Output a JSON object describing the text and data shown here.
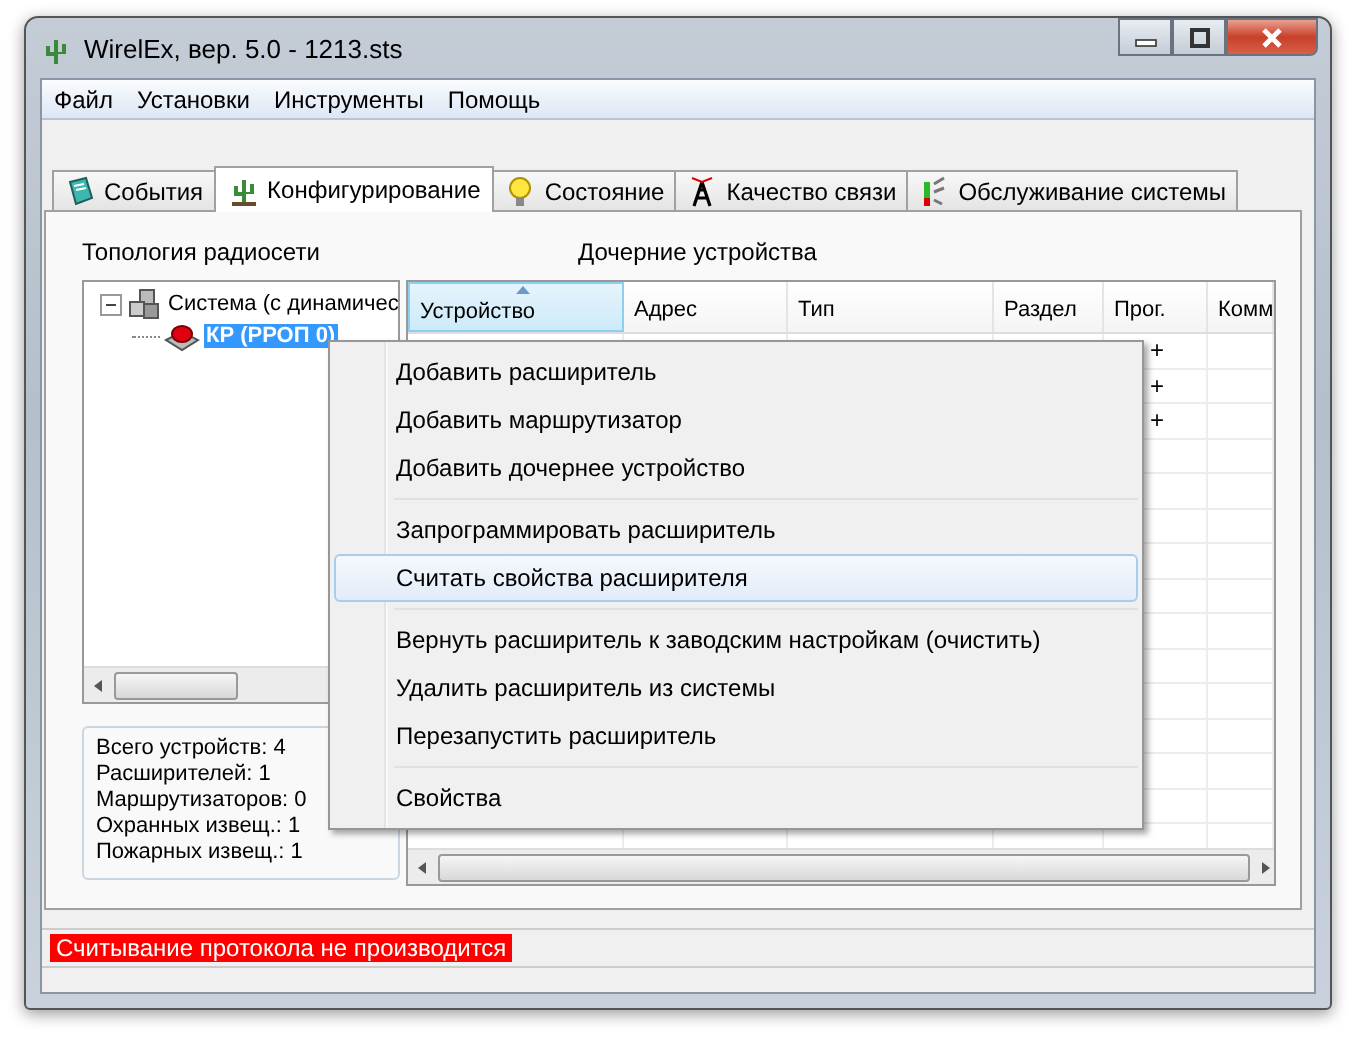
{
  "window": {
    "title": "WirelEx, вер. 5.0 - 1213.sts"
  },
  "menu": [
    "Файл",
    "Установки",
    "Инструменты",
    "Помощь"
  ],
  "tabs": [
    {
      "label": "События",
      "kind": "book",
      "selected": false
    },
    {
      "label": "Конфигурирование",
      "kind": "cactus",
      "selected": true
    },
    {
      "label": "Состояние",
      "kind": "bulb",
      "selected": false
    },
    {
      "label": "Качество связи",
      "kind": "antenna",
      "selected": false
    },
    {
      "label": "Обслуживание системы",
      "kind": "gauge",
      "selected": false
    }
  ],
  "topology": {
    "title": "Топология радиосети",
    "tree": [
      {
        "label": "Система (с динамичес",
        "kind": "system",
        "expanded": true,
        "selected": false,
        "children": [
          {
            "label": "КР (РРОП 0)",
            "kind": "device",
            "selected": true
          }
        ]
      }
    ]
  },
  "summary": [
    "Всего устройств: 4",
    "Расширителей: 1",
    "Маршрутизаторов: 0",
    "Охранных извещ.: 1",
    "Пожарных извещ.: 1"
  ],
  "children_table": {
    "title": "Дочерние устройства",
    "columns": [
      {
        "label": "Устройство",
        "sorted": true
      },
      {
        "label": "Адрес",
        "sorted": false
      },
      {
        "label": "Тип",
        "sorted": false
      },
      {
        "label": "Раздел",
        "sorted": false
      },
      {
        "label": "Прог.",
        "sorted": false
      },
      {
        "label": "Комм",
        "sorted": false
      }
    ],
    "rows": [
      {
        "prog": "+"
      },
      {
        "prog": "+"
      },
      {
        "prog": "+"
      }
    ]
  },
  "context_menu": {
    "groups": [
      [
        {
          "label": "Добавить расширитель",
          "selected": false
        },
        {
          "label": "Добавить маршрутизатор",
          "selected": false
        },
        {
          "label": "Добавить дочернее устройство",
          "selected": false
        }
      ],
      [
        {
          "label": "Запрограммировать расширитель",
          "selected": false
        },
        {
          "label": "Считать свойства расширителя",
          "selected": true
        }
      ],
      [
        {
          "label": "Вернуть расширитель к заводским настройкам (очистить)",
          "selected": false
        },
        {
          "label": "Удалить расширитель из системы",
          "selected": false
        },
        {
          "label": "Перезапустить расширитель",
          "selected": false
        }
      ],
      [
        {
          "label": "Свойства",
          "selected": false
        }
      ]
    ]
  },
  "status_bar": {
    "message": "Считывание протокола не производится",
    "alert": true
  }
}
